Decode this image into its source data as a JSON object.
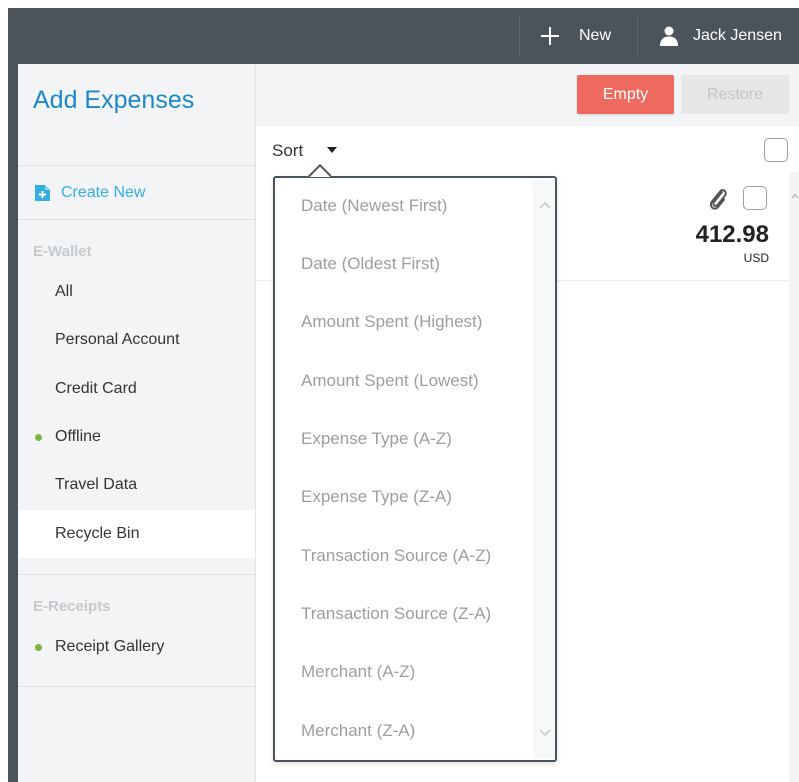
{
  "header": {
    "new_label": "New",
    "user_name": "Jack Jensen"
  },
  "sidebar": {
    "title": "Add Expenses",
    "create_new": "Create New",
    "sections": [
      {
        "label": "E-Wallet",
        "items": [
          {
            "label": "All",
            "dot": false,
            "active": false
          },
          {
            "label": "Personal Account",
            "dot": false,
            "active": false
          },
          {
            "label": "Credit Card",
            "dot": false,
            "active": false
          },
          {
            "label": "Offline",
            "dot": true,
            "active": false
          },
          {
            "label": "Travel Data",
            "dot": false,
            "active": false
          },
          {
            "label": "Recycle Bin",
            "dot": false,
            "active": true
          }
        ]
      },
      {
        "label": "E-Receipts",
        "items": [
          {
            "label": "Receipt Gallery",
            "dot": true,
            "active": false
          }
        ]
      }
    ]
  },
  "toolbar": {
    "empty_label": "Empty",
    "restore_label": "Restore"
  },
  "sort": {
    "label": "Sort",
    "options": [
      "Date (Newest First)",
      "Date (Oldest First)",
      "Amount Spent (Highest)",
      "Amount Spent (Lowest)",
      "Expense Type (A-Z)",
      "Expense Type (Z-A)",
      "Transaction Source (A-Z)",
      "Transaction Source (Z-A)",
      "Merchant (A-Z)",
      "Merchant (Z-A)"
    ]
  },
  "expense": {
    "amount": "412.98",
    "currency": "USD"
  },
  "colors": {
    "header_bg": "#4b535b",
    "accent_blue": "#1e88c8",
    "create_new": "#35aee2",
    "empty_button": "#ee6a5e",
    "status_dot": "#7cb342"
  }
}
